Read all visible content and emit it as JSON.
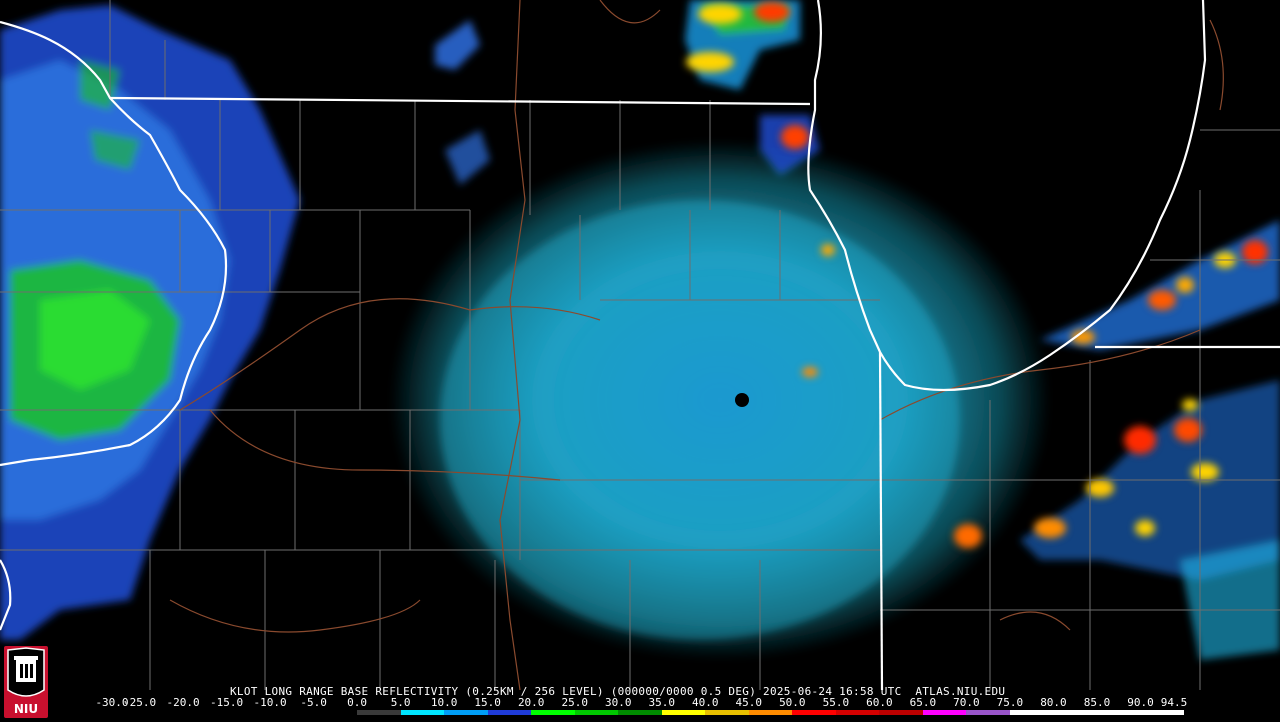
{
  "header": {
    "title": "KLOT LONG RANGE BASE REFLECTIVITY (0.25KM / 256 LEVEL) (000000/0000 0.5 DEG) 2025-06-24 16:58 UTC  ATLAS.NIU.EDU"
  },
  "logo": {
    "text": "NIU",
    "icon": "niu-seal-icon"
  },
  "colorbar": {
    "labels": [
      "-30.0",
      "-25.0",
      "-20.0",
      "-15.0",
      "-10.0",
      "-5.0",
      "0.0",
      "5.0",
      "10.0",
      "15.0",
      "20.0",
      "25.0",
      "30.0",
      "35.0",
      "40.0",
      "45.0",
      "50.0",
      "55.0",
      "60.0",
      "65.0",
      "70.0",
      "75.0",
      "80.0",
      "85.0",
      "90.0",
      "94.5"
    ],
    "colors": [
      "#000000",
      "#000000",
      "#000000",
      "#000000",
      "#000000",
      "#000000",
      "#3a3a3a",
      "#00e5ff",
      "#009df5",
      "#1f3bd8",
      "#00ff00",
      "#00c800",
      "#008c00",
      "#ffff00",
      "#e8c000",
      "#ff8c00",
      "#ff0000",
      "#d40000",
      "#bc0000",
      "#ff00ff",
      "#9955c9",
      "#ffffff",
      "#ffffff",
      "#ffffff",
      "#ffffff"
    ]
  },
  "map_colors": {
    "background": "#000000",
    "state_lines": "#ffffff",
    "county_lines": "#6e6e6e",
    "rivers": "#8a4a2e",
    "radar_site": "#000000"
  }
}
